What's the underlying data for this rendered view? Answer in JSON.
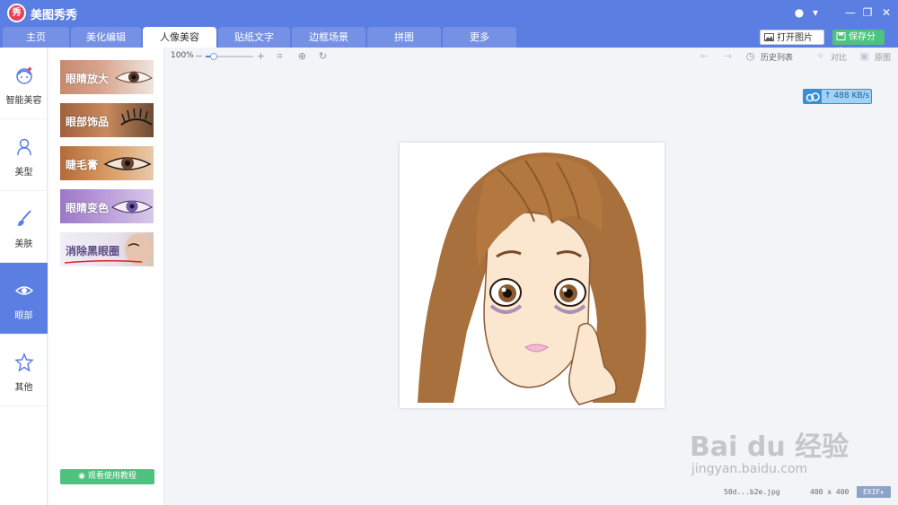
{
  "app": {
    "title": "美图秀秀",
    "logo_text": "秀"
  },
  "tabs": [
    "主页",
    "美化编辑",
    "人像美容",
    "贴纸文字",
    "边框场景",
    "拼图",
    "更多"
  ],
  "header_buttons": {
    "open": "打开图片",
    "save": "保存分享"
  },
  "left_nav": [
    "智能美容",
    "美型",
    "美肤",
    "眼部",
    "其他"
  ],
  "features": [
    "眼睛放大",
    "眼部饰品",
    "睫毛膏",
    "眼睛变色",
    "消除黑眼圈"
  ],
  "tutorial_button": "观看使用教程",
  "toolbar": {
    "zoom": "100%",
    "history": "历史列表",
    "compare": "对比",
    "original": "原图"
  },
  "speed": "488 KB/s",
  "status": {
    "file_name": "50d...b2e.jpg",
    "dimensions": "400 x 400",
    "exif": "EXIF"
  },
  "watermark": {
    "logo": "Bai du 经验",
    "url": "jingyan.baidu.com"
  },
  "colors": {
    "accent": "#5b7ee3",
    "green": "#4ec27f",
    "logo": "#e8415b"
  }
}
